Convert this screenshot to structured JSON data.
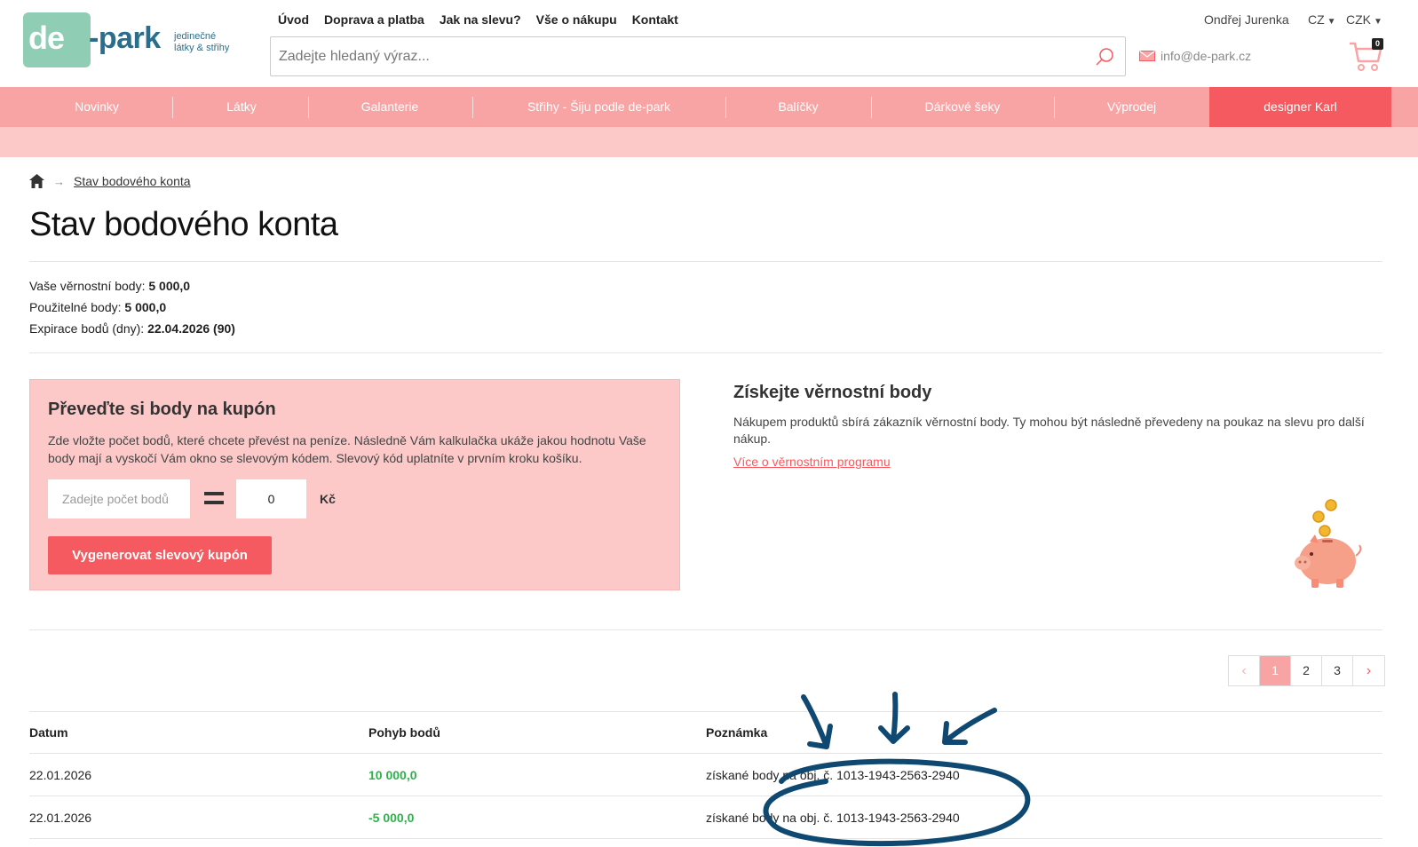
{
  "logo": {
    "de": "de",
    "park": "-park",
    "tagline_1": "jedinečné",
    "tagline_2": "látky & střihy"
  },
  "topnav": [
    "Úvod",
    "Doprava a platba",
    "Jak na slevu?",
    "Vše o nákupu",
    "Kontakt"
  ],
  "search": {
    "placeholder": "Zadejte hledaný výraz..."
  },
  "user": {
    "name": "Ondřej Jurenka",
    "language": "CZ",
    "currency": "CZK",
    "email": "info@de-park.cz",
    "cart_count": "0"
  },
  "categories": [
    "Novinky",
    "Látky",
    "Galanterie",
    "Střihy - Šiju podle de-park",
    "Balíčky",
    "Dárkové šeky",
    "Výprodej",
    "designer Karl"
  ],
  "breadcrumb": {
    "current": "Stav bodového konta"
  },
  "page": {
    "title": "Stav bodového konta"
  },
  "stats": {
    "loyalty_label": "Vaše věrnostní body:",
    "loyalty_value": "5 000,0",
    "usable_label": "Použitelné body:",
    "usable_value": "5 000,0",
    "expiry_label": "Expirace bodů (dny):",
    "expiry_value": "22.04.2026 (90)"
  },
  "coupon": {
    "title": "Převeďte si body na kupón",
    "description": "Zde vložte počet bodů, které chcete převést na peníze. Následně Vám kalkulačka ukáže jakou hodnotu Vaše body mají a vyskočí Vám okno se slevovým kódem. Slevový kód uplatníte v prvním kroku košíku.",
    "input_placeholder": "Zadejte počet bodů",
    "value": "0",
    "currency": "Kč",
    "button": "Vygenerovat slevový kupón"
  },
  "info": {
    "title": "Získejte věrnostní body",
    "text": "Nákupem produktů sbírá zákazník věrnostní body. Ty mohou být následně převedeny na poukaz na slevu pro další nákup.",
    "link": "Více o věrnostním programu"
  },
  "pagination": {
    "pages": [
      "1",
      "2",
      "3"
    ],
    "active": "1",
    "prev": "‹",
    "next": "›"
  },
  "table": {
    "headers": [
      "Datum",
      "Pohyb bodů",
      "Poznámka"
    ],
    "rows": [
      {
        "date": "22.01.2026",
        "points": "10 000,0",
        "note": "získané body na obj. č. 1013-1943-2563-2940"
      },
      {
        "date": "22.01.2026",
        "points": "-5 000,0",
        "note": "získané body na obj. č. 1013-1943-2563-2940"
      }
    ]
  },
  "colors": {
    "accent": "#f45a5f",
    "nav": "#f8a4a4",
    "nav_light": "#fdc8c8",
    "positive": "#2db14a",
    "brand": "#2a6e8e",
    "annotation": "#0f4870"
  }
}
